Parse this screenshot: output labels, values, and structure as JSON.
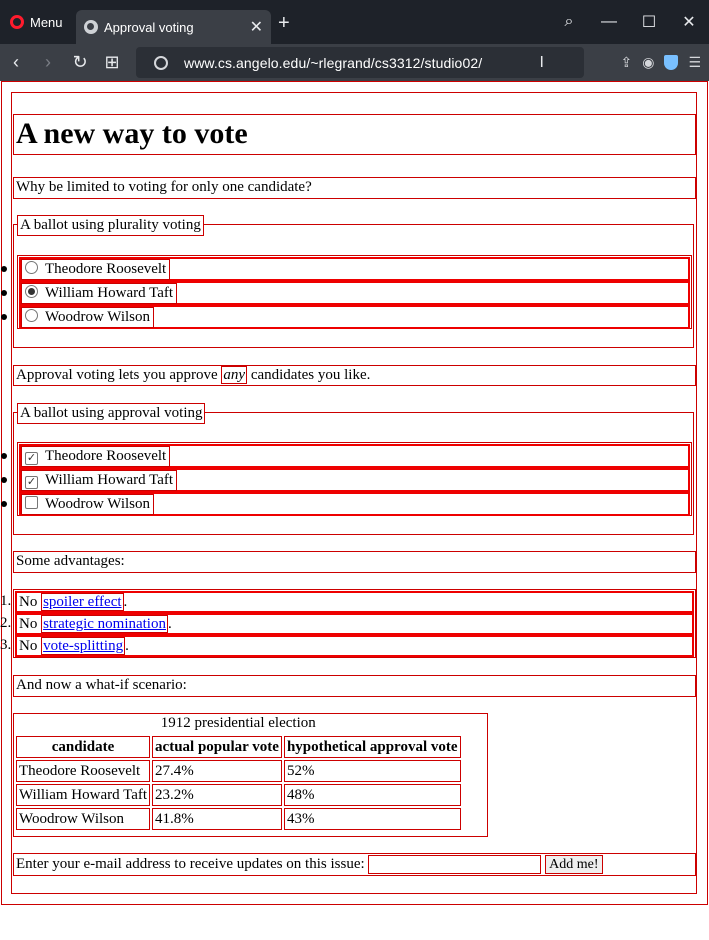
{
  "browser": {
    "menu_label": "Menu",
    "tab_title": "Approval voting",
    "url": "www.cs.angelo.edu/~rlegrand/cs3312/studio02/"
  },
  "page": {
    "heading": "A new way to vote",
    "intro": "Why be limited to voting for only one candidate?",
    "plurality": {
      "legend": "A ballot using plurality voting",
      "options": [
        {
          "label": "Theodore Roosevelt",
          "checked": false
        },
        {
          "label": "William Howard Taft",
          "checked": true
        },
        {
          "label": "Woodrow Wilson",
          "checked": false
        }
      ]
    },
    "approval_intro": {
      "before": "Approval voting lets you approve ",
      "emphasis": "any",
      "after": " candidates you like."
    },
    "approval": {
      "legend": "A ballot using approval voting",
      "options": [
        {
          "label": "Theodore Roosevelt",
          "checked": true
        },
        {
          "label": "William Howard Taft",
          "checked": true
        },
        {
          "label": "Woodrow Wilson",
          "checked": false
        }
      ]
    },
    "advantages_intro": "Some advantages:",
    "advantages": [
      {
        "number": "1.",
        "prefix": "No ",
        "link": "spoiler effect",
        "suffix": "."
      },
      {
        "number": "2.",
        "prefix": "No ",
        "link": "strategic nomination",
        "suffix": "."
      },
      {
        "number": "3.",
        "prefix": "No ",
        "link": "vote-splitting",
        "suffix": "."
      }
    ],
    "whatif": "And now a what-if scenario:",
    "table": {
      "caption": "1912 presidential election",
      "headers": [
        "candidate",
        "actual popular vote",
        "hypothetical approval vote"
      ],
      "rows": [
        [
          "Theodore Roosevelt",
          "27.4%",
          "52%"
        ],
        [
          "William Howard Taft",
          "23.2%",
          "48%"
        ],
        [
          "Woodrow Wilson",
          "41.8%",
          "43%"
        ]
      ]
    },
    "email": {
      "label": "Enter your e-mail address to receive updates on this issue:",
      "value": "",
      "button": "Add me!"
    }
  }
}
